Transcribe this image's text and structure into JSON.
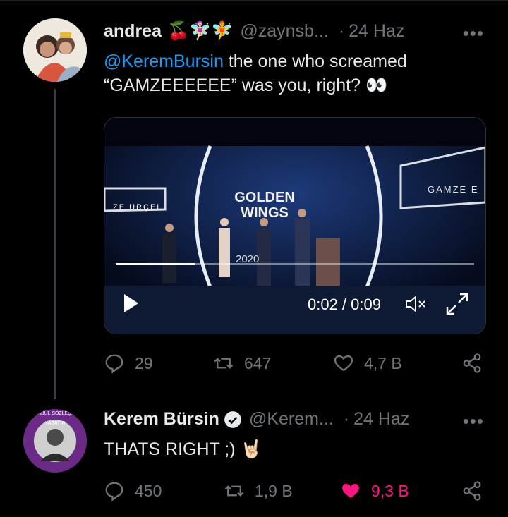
{
  "tweet1": {
    "display_name": "andrea",
    "emoji": "🍒🧚🏻‍♀️🧚",
    "handle": "@zaynsb...",
    "separator": "·",
    "date": "24 Haz",
    "more_label": "•••",
    "mention": "@KeremBursin",
    "text_line1": " the one who screamed",
    "text_line2": "“GAMZEEEEEE” was you, right? 👀",
    "video": {
      "time": "0:02 / 0:09",
      "progress": 0.22,
      "sign_left": "ZE URÇEL",
      "sign_right": "GAMZE E",
      "logo": "GOLDEN WINGS",
      "year": "2020"
    },
    "actions": {
      "replies": "29",
      "retweets": "647",
      "likes": "4,7 B"
    }
  },
  "tweet2": {
    "display_name": "Kerem Bürsin",
    "handle": "@Kerem...",
    "separator": "·",
    "date": "24 Haz",
    "more_label": "•••",
    "text": "THATS RIGHT ;) 🤘🏻",
    "avatar_ring_text": "İSTANBUL SÖZLEŞMESİ YAŞATIR",
    "actions": {
      "replies": "450",
      "retweets": "1,9 B",
      "likes": "9,3 B"
    }
  },
  "colors": {
    "accent": "#1d9bf0",
    "like_active": "#f91880",
    "muted": "#71767b",
    "badge": "#6b2a86"
  }
}
